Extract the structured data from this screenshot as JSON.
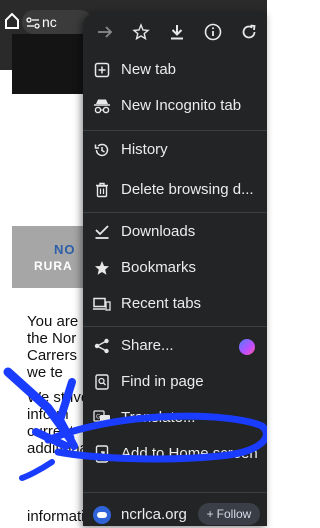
{
  "toolbar": {
    "url_text": "nc",
    "home_icon": "home-icon",
    "tune_icon": "site-settings-icon"
  },
  "page": {
    "banner_line1": "NO",
    "banner_line2": "RURA",
    "paragraph1": "You are\nthe Nor\nCarrers\nwe te",
    "paragraph2": "We strive\ninform\ncurrent\nadditional pertinent",
    "bottom_line": "information that you have or"
  },
  "menu": {
    "top_icons": [
      "forward-icon",
      "bookmark-star-icon",
      "download-icon",
      "info-icon",
      "refresh-icon"
    ],
    "items": [
      {
        "label": "New tab",
        "icon": "new-tab-icon"
      },
      {
        "label": "New Incognito tab",
        "icon": "incognito-icon"
      },
      {
        "label": "History",
        "icon": "history-icon"
      },
      {
        "label": "Delete browsing d...",
        "icon": "trash-icon"
      },
      {
        "label": "Downloads",
        "icon": "downloads-icon"
      },
      {
        "label": "Bookmarks",
        "icon": "bookmarks-star-icon"
      },
      {
        "label": "Recent tabs",
        "icon": "recent-tabs-icon"
      },
      {
        "label": "Share...",
        "icon": "share-icon"
      },
      {
        "label": "Find in page",
        "icon": "find-in-page-icon"
      },
      {
        "label": "Translate...",
        "icon": "translate-icon"
      },
      {
        "label": "Add to Home screen",
        "icon": "add-to-home-icon"
      }
    ],
    "site": "ncrlca.org",
    "follow_label": "Follow",
    "follow_plus": "+"
  },
  "colors": {
    "menu_bg": "#222426",
    "annotation_blue": "#1a3cff",
    "follow_bg": "#3a3f47"
  }
}
